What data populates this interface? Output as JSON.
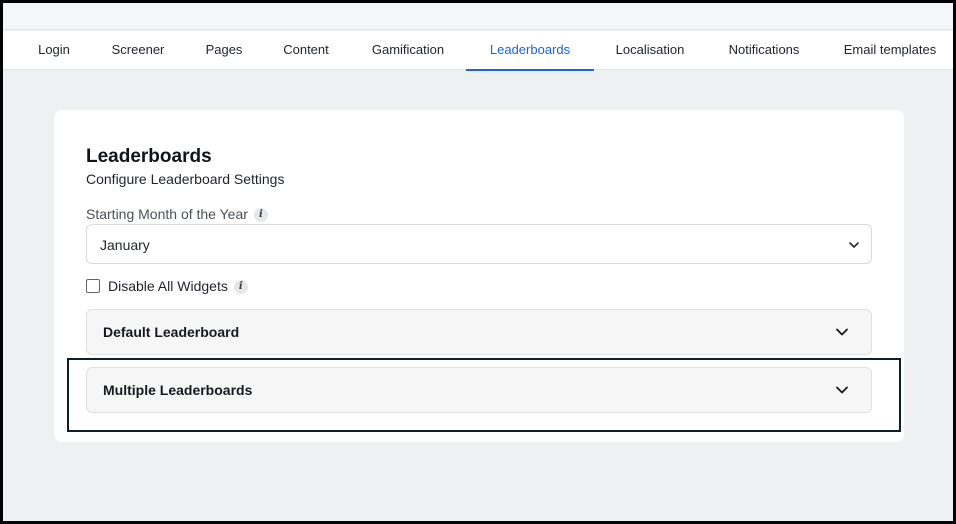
{
  "tabs": [
    {
      "label": "Login",
      "active": false
    },
    {
      "label": "Screener",
      "active": false
    },
    {
      "label": "Pages",
      "active": false
    },
    {
      "label": "Content",
      "active": false
    },
    {
      "label": "Gamification",
      "active": false
    },
    {
      "label": "Leaderboards",
      "active": true
    },
    {
      "label": "Localisation",
      "active": false
    },
    {
      "label": "Notifications",
      "active": false
    },
    {
      "label": "Email templates",
      "active": false
    }
  ],
  "card": {
    "title": "Leaderboards",
    "subtitle": "Configure Leaderboard Settings",
    "starting_month": {
      "label": "Starting Month of the Year",
      "value": "January",
      "info_icon": "info-icon"
    },
    "disable_widgets": {
      "label": "Disable All Widgets",
      "checked": false,
      "info_icon": "info-icon"
    },
    "accordions": [
      {
        "title": "Default Leaderboard",
        "icon": "chevron-down-icon"
      },
      {
        "title": "Multiple Leaderboards",
        "icon": "chevron-down-icon"
      }
    ]
  },
  "colors": {
    "accent": "#1a66d6",
    "highlight_border": "#0e2026",
    "page_background": "#eff0f1"
  }
}
